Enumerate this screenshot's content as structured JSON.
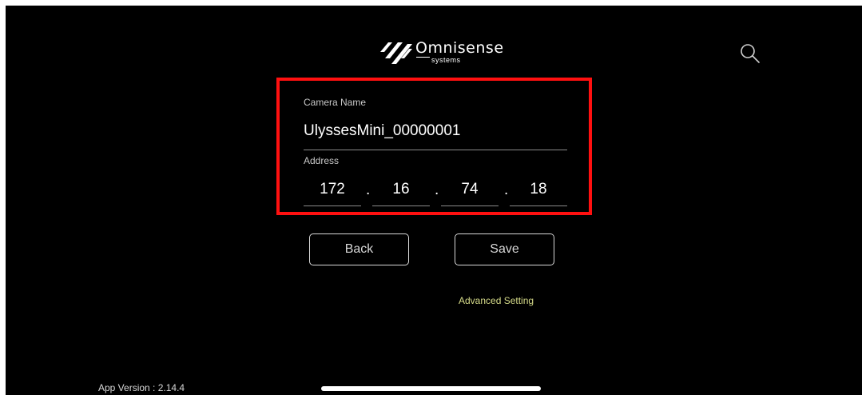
{
  "header": {
    "logo_name": "Omnisense",
    "logo_sub": "systems",
    "search_icon": "search-icon"
  },
  "form": {
    "camera_name_label": "Camera Name",
    "camera_name_value": "UlyssesMini_00000001",
    "address_label": "Address",
    "address_octets": [
      "172",
      "16",
      "74",
      "18"
    ],
    "separator": "."
  },
  "buttons": {
    "back_label": "Back",
    "save_label": "Save"
  },
  "advanced_label": "Advanced Setting",
  "footer": {
    "version_text": "App Version : 2.14.4"
  },
  "colors": {
    "background": "#000000",
    "highlight_border": "#ff1010",
    "advanced_link": "#d7dc8a"
  }
}
